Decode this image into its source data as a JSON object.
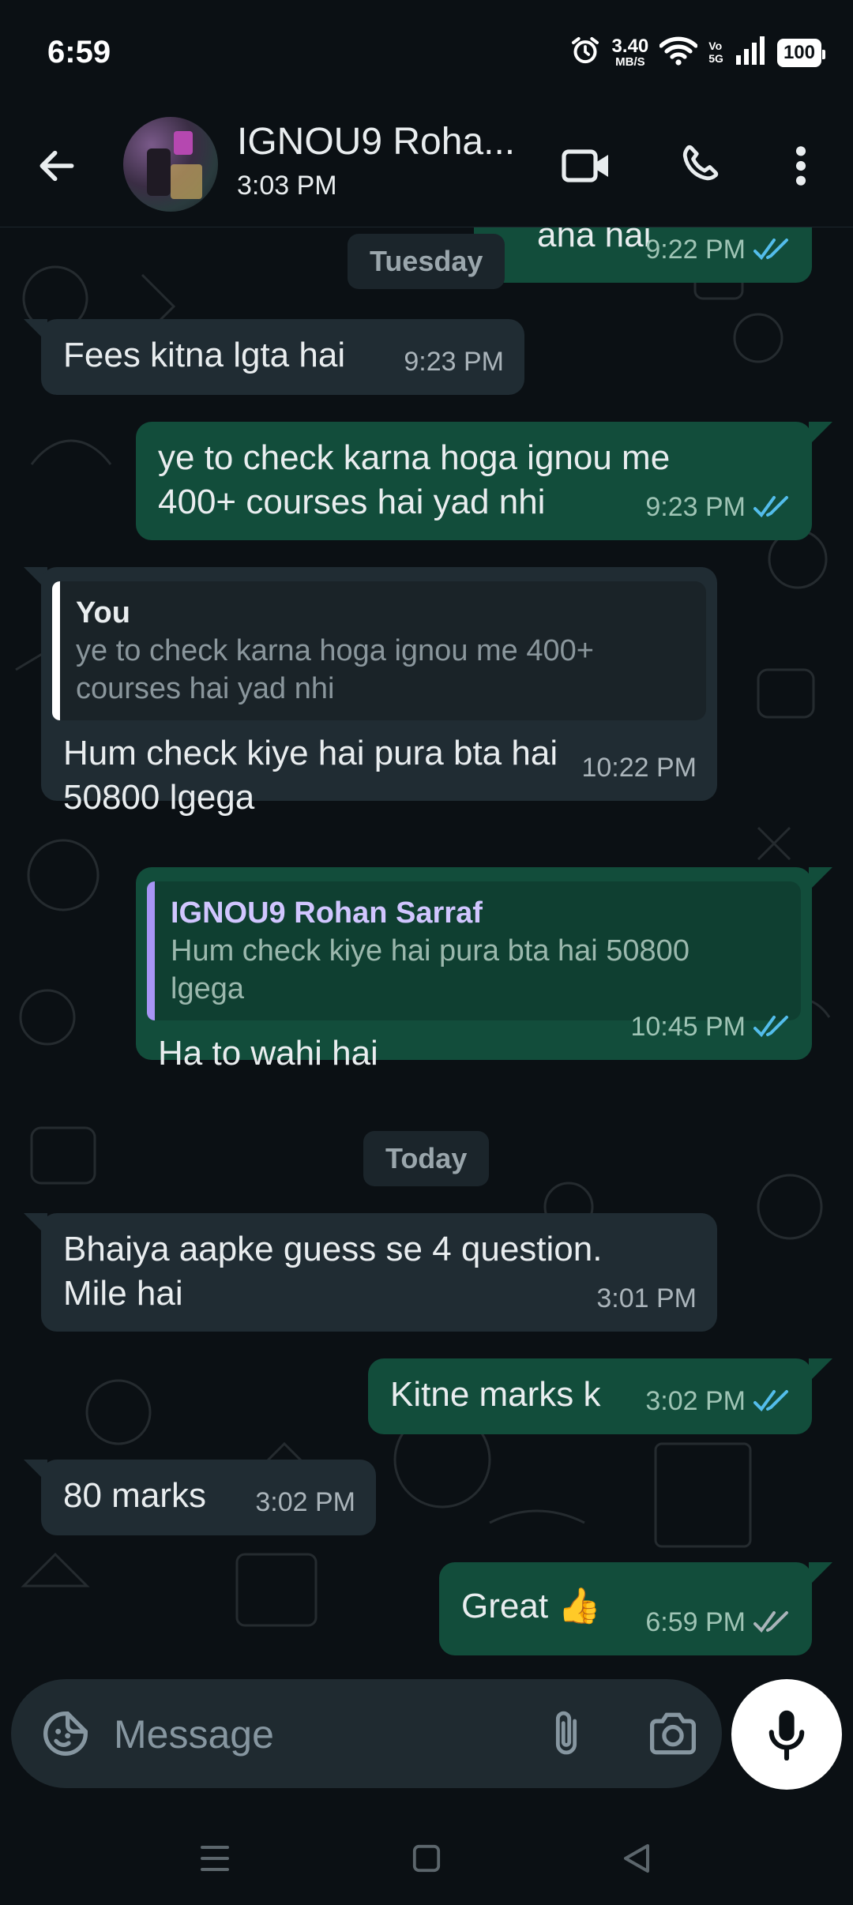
{
  "status_bar": {
    "time": "6:59",
    "net_speed_value": "3.40",
    "net_speed_unit": "MB/S",
    "volte_top": "Vo",
    "volte_bottom": "5G",
    "battery": "100"
  },
  "header": {
    "contact_name": "IGNOU9 Roha...",
    "last_seen": "3:03 PM",
    "icons": [
      "back-arrow-icon",
      "video-call-icon",
      "voice-call-icon",
      "more-options-icon"
    ]
  },
  "chat": {
    "partial_top": {
      "text": "aha hai",
      "time": "9:22 PM",
      "status": "read"
    },
    "date_tuesday": "Tuesday",
    "messages": [
      {
        "dir": "in",
        "text": "Fees kitna lgta hai",
        "time": "9:23 PM"
      },
      {
        "dir": "out",
        "text_line1": "ye to check karna hoga ignou me",
        "text_line2": "400+ courses hai yad nhi",
        "time": "9:23 PM",
        "status": "read"
      },
      {
        "dir": "in",
        "quote_name": "You",
        "quote_line1": "ye to check karna hoga ignou me 400+",
        "quote_line2": "courses hai yad nhi",
        "text_line1": "Hum check kiye hai pura bta hai",
        "text_line2": "50800 lgega",
        "time": "10:22 PM"
      },
      {
        "dir": "out",
        "quote_name": "IGNOU9 Rohan Sarraf",
        "quote_line1": "Hum check kiye hai pura bta hai 50800",
        "quote_line2": "lgega",
        "text": "Ha to wahi hai",
        "time": "10:45 PM",
        "status": "read"
      }
    ],
    "date_today": "Today",
    "messages_today": [
      {
        "dir": "in",
        "text_line1": "Bhaiya aapke guess se 4 question.",
        "text_line2": "Mile hai",
        "time": "3:01 PM"
      },
      {
        "dir": "out",
        "text": "Kitne marks k",
        "time": "3:02 PM",
        "status": "read"
      },
      {
        "dir": "in",
        "text": "80 marks",
        "time": "3:02 PM"
      },
      {
        "dir": "out",
        "text": "Great 👍",
        "time": "6:59 PM",
        "status": "delivered"
      }
    ],
    "colors": {
      "incoming": "#202c33",
      "outgoing": "#124d3b",
      "read_ticks": "#53bdeb",
      "delivered_ticks": "#aab4ba"
    }
  },
  "input": {
    "placeholder": "Message",
    "icons": [
      "emoji-sticker-icon",
      "attach-icon",
      "camera-icon",
      "mic-icon"
    ]
  },
  "nav": {
    "icons": [
      "recents-icon",
      "home-icon",
      "back-icon"
    ]
  }
}
